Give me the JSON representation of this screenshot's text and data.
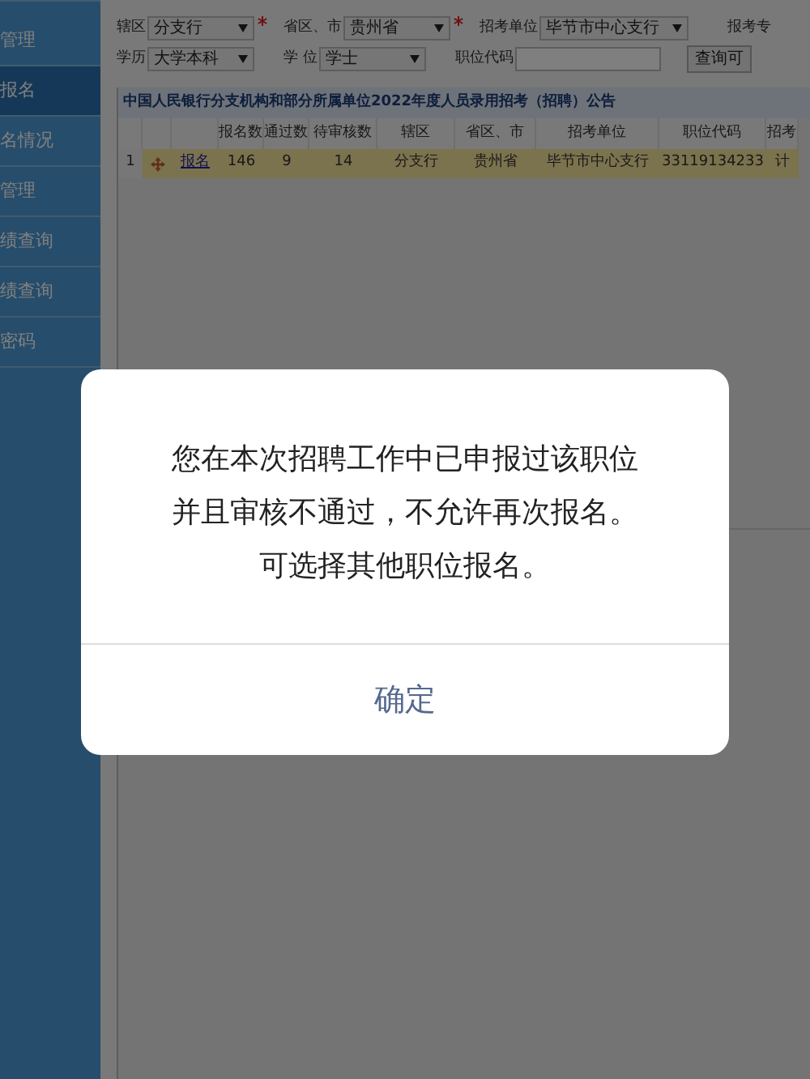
{
  "sidebar": {
    "items": [
      {
        "label": "管理",
        "selected": false
      },
      {
        "label": "报名",
        "selected": true
      },
      {
        "label": "名情况",
        "selected": false
      },
      {
        "label": "管理",
        "selected": false
      },
      {
        "label": "绩查询",
        "selected": false
      },
      {
        "label": "绩查询",
        "selected": false
      },
      {
        "label": "密码",
        "selected": false
      }
    ]
  },
  "filters": [
    [
      {
        "kind": "select",
        "label": "辖区",
        "value": "分支行",
        "required": true
      },
      {
        "kind": "select",
        "label": "省区、市",
        "value": "贵州省",
        "required": true
      },
      {
        "kind": "select",
        "label": "招考单位",
        "value": "毕节市中心支行",
        "required": false
      },
      {
        "kind": "label",
        "label": "报考专"
      }
    ],
    [
      {
        "kind": "select",
        "label": "学历",
        "value": "大学本科",
        "required": false
      },
      {
        "kind": "select",
        "label": "学 位",
        "value": "学士",
        "required": false
      },
      {
        "kind": "input",
        "label": "职位代码"
      },
      {
        "kind": "button",
        "label": "查询可"
      }
    ]
  ],
  "table": {
    "title": "中国人民银行分支机构和部分所属单位2022年度人员录用招考（招聘）公告",
    "columns": [
      "报名数",
      "通过数",
      "待审核数",
      "辖区",
      "省区、市",
      "招考单位",
      "职位代码",
      "招考"
    ],
    "rows": [
      {
        "index": "1",
        "link": "报名",
        "selected": true,
        "cells": [
          "146",
          "9",
          "14",
          "分支行",
          "贵州省",
          "毕节市中心支行",
          "33119134233",
          "计"
        ]
      }
    ]
  },
  "dialog": {
    "message": [
      "您在本次招聘工作中已申报过该职位",
      "并且审核不通过，不允许再次报名。",
      "可选择其他职位报名。"
    ],
    "button": "确定"
  }
}
